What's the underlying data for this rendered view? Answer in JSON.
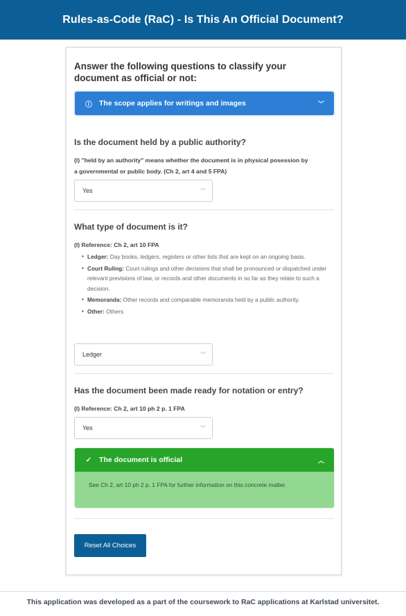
{
  "header": {
    "title": "Rules-as-Code (RaC) - Is This An Official Document?"
  },
  "intro": "Answer the following questions to classify your document as official or not:",
  "scope": {
    "label": "The scope applies for writings and images",
    "icon": "info-icon",
    "color": "#2d7fd6"
  },
  "questions": [
    {
      "title": "Is the document held by a public authority?",
      "hint": "(I) \"held by an authority\" means whether the document is in physical posession by a governmental or public body. (Ch 2, art 4 and 5 FPA)",
      "selected": "Yes"
    },
    {
      "title": "What type of document is it?",
      "hint": "(I) Reference: Ch 2, art 10 FPA",
      "options": [
        {
          "term": "Ledger:",
          "desc": "Day books, ledgers, registers or other lists that are kept on an ongoing basis."
        },
        {
          "term": "Court Ruling:",
          "desc": "Court rulings and other decisions that shall be pronounced or dispatched under relevant previsions of law, or records and other documents in so far as they relate to such a decision."
        },
        {
          "term": "Memoranda:",
          "desc": "Other records and comparable memoranda held by a public authority."
        },
        {
          "term": "Other:",
          "desc": "Others"
        }
      ],
      "selected": "Ledger"
    },
    {
      "title": "Has the document been made ready for notation or entry?",
      "hint": "(I) Reference: Ch 2, art 10 ph 2 p. 1 FPA",
      "selected": "Yes"
    }
  ],
  "result": {
    "label": "The document is official",
    "icon": "check-circle-icon",
    "detail": "See Ch 2, art 10 ph 2 p. 1 FPA for further information on this concrete matter.",
    "color": "#27a52a"
  },
  "reset_label": "Reset All Choices",
  "footer": "This application was developed as a part of the coursework to RaC applications at Karlstad universitet.",
  "colors": {
    "brand": "#0c5f96",
    "info": "#2d7fd6",
    "success": "#27a52a"
  }
}
